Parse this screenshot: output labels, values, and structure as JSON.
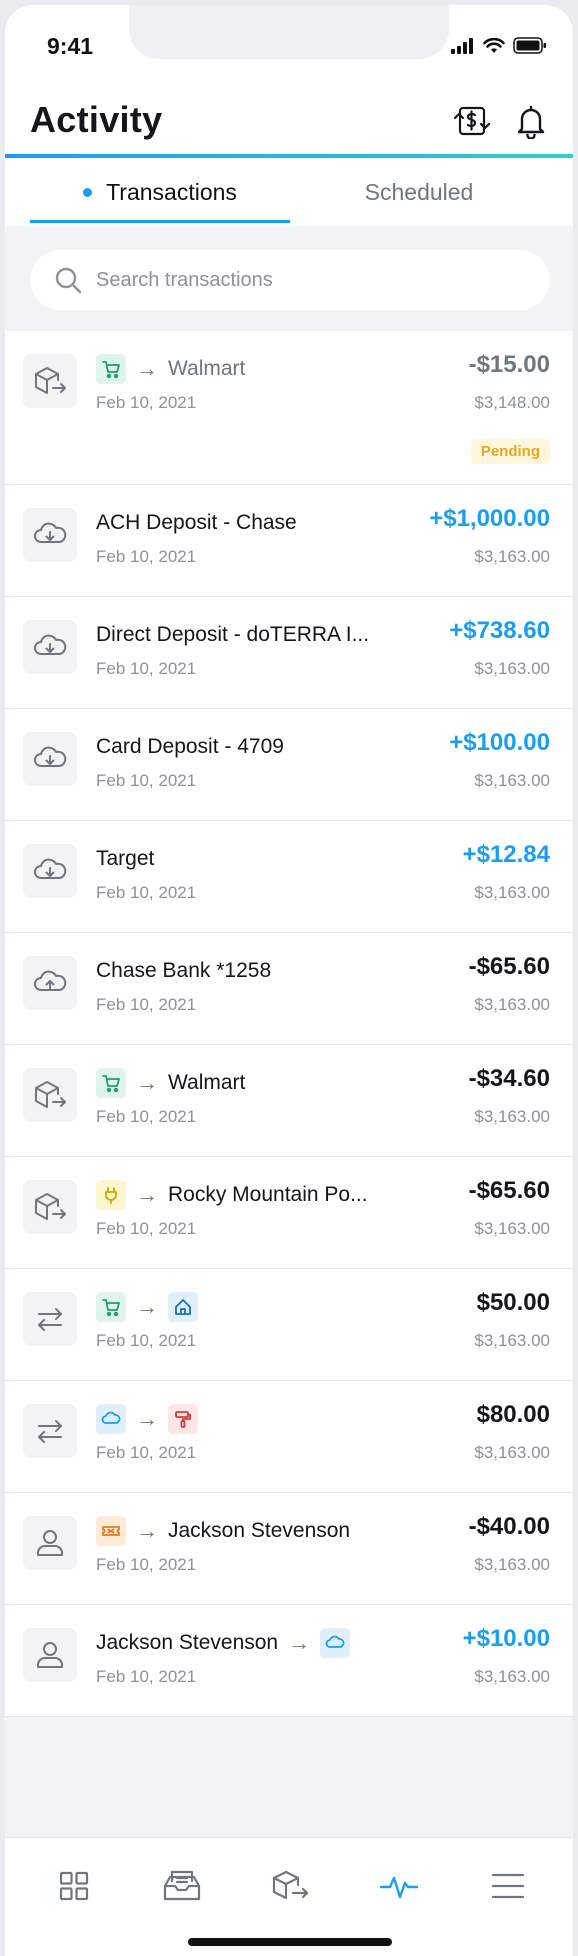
{
  "status": {
    "time": "9:41"
  },
  "header": {
    "title": "Activity"
  },
  "tabs": [
    {
      "label": "Transactions",
      "active": true
    },
    {
      "label": "Scheduled",
      "active": false
    }
  ],
  "search": {
    "placeholder": "Search transactions"
  },
  "colors": {
    "accent": "#1a9ff0",
    "positive": "#1a9ff0",
    "pending_bg": "#fff6dd",
    "pending_fg": "#e6a81e"
  },
  "transactions": [
    {
      "icon": "box-out-icon",
      "from_icon": "cart-icon",
      "title": "Walmart",
      "date": "Feb 10, 2021",
      "amount": "-$15.00",
      "balance": "$3,148.00",
      "status": "Pending"
    },
    {
      "icon": "cloud-download-icon",
      "title": "ACH Deposit - Chase",
      "date": "Feb 10, 2021",
      "amount": "+$1,000.00",
      "balance": "$3,163.00"
    },
    {
      "icon": "cloud-download-icon",
      "title": "Direct Deposit - doTERRA I...",
      "date": "Feb 10, 2021",
      "amount": "+$738.60",
      "balance": "$3,163.00"
    },
    {
      "icon": "cloud-download-icon",
      "title": "Card Deposit - 4709",
      "date": "Feb 10, 2021",
      "amount": "+$100.00",
      "balance": "$3,163.00"
    },
    {
      "icon": "cloud-download-icon",
      "title": "Target",
      "date": "Feb 10, 2021",
      "amount": "+$12.84",
      "balance": "$3,163.00"
    },
    {
      "icon": "cloud-upload-icon",
      "title": "Chase Bank *1258",
      "date": "Feb 10, 2021",
      "amount": "-$65.60",
      "balance": "$3,163.00"
    },
    {
      "icon": "box-out-icon",
      "from_icon": "cart-icon",
      "title": "Walmart",
      "date": "Feb 10, 2021",
      "amount": "-$34.60",
      "balance": "$3,163.00"
    },
    {
      "icon": "box-out-icon",
      "from_icon": "plug-icon",
      "title": "Rocky Mountain Po...",
      "date": "Feb 10, 2021",
      "amount": "-$65.60",
      "balance": "$3,163.00"
    },
    {
      "icon": "transfer-icon",
      "from_icon": "cart-icon",
      "to_icon": "home-icon",
      "date": "Feb 10, 2021",
      "amount": "$50.00",
      "balance": "$3,163.00"
    },
    {
      "icon": "transfer-icon",
      "from_icon": "cloud-icon",
      "to_icon": "paint-roller-icon",
      "date": "Feb 10, 2021",
      "amount": "$80.00",
      "balance": "$3,163.00"
    },
    {
      "icon": "person-icon",
      "from_icon": "ticket-icon",
      "title": "Jackson Stevenson",
      "date": "Feb 10, 2021",
      "amount": "-$40.00",
      "balance": "$3,163.00"
    },
    {
      "icon": "person-icon",
      "title": "Jackson Stevenson",
      "to_icon": "cloud-icon",
      "date": "Feb 10, 2021",
      "amount": "+$10.00",
      "balance": "$3,163.00"
    }
  ],
  "tabbar": [
    "dashboard-icon",
    "inbox-icon",
    "box-out-icon",
    "activity-icon",
    "menu-icon"
  ]
}
